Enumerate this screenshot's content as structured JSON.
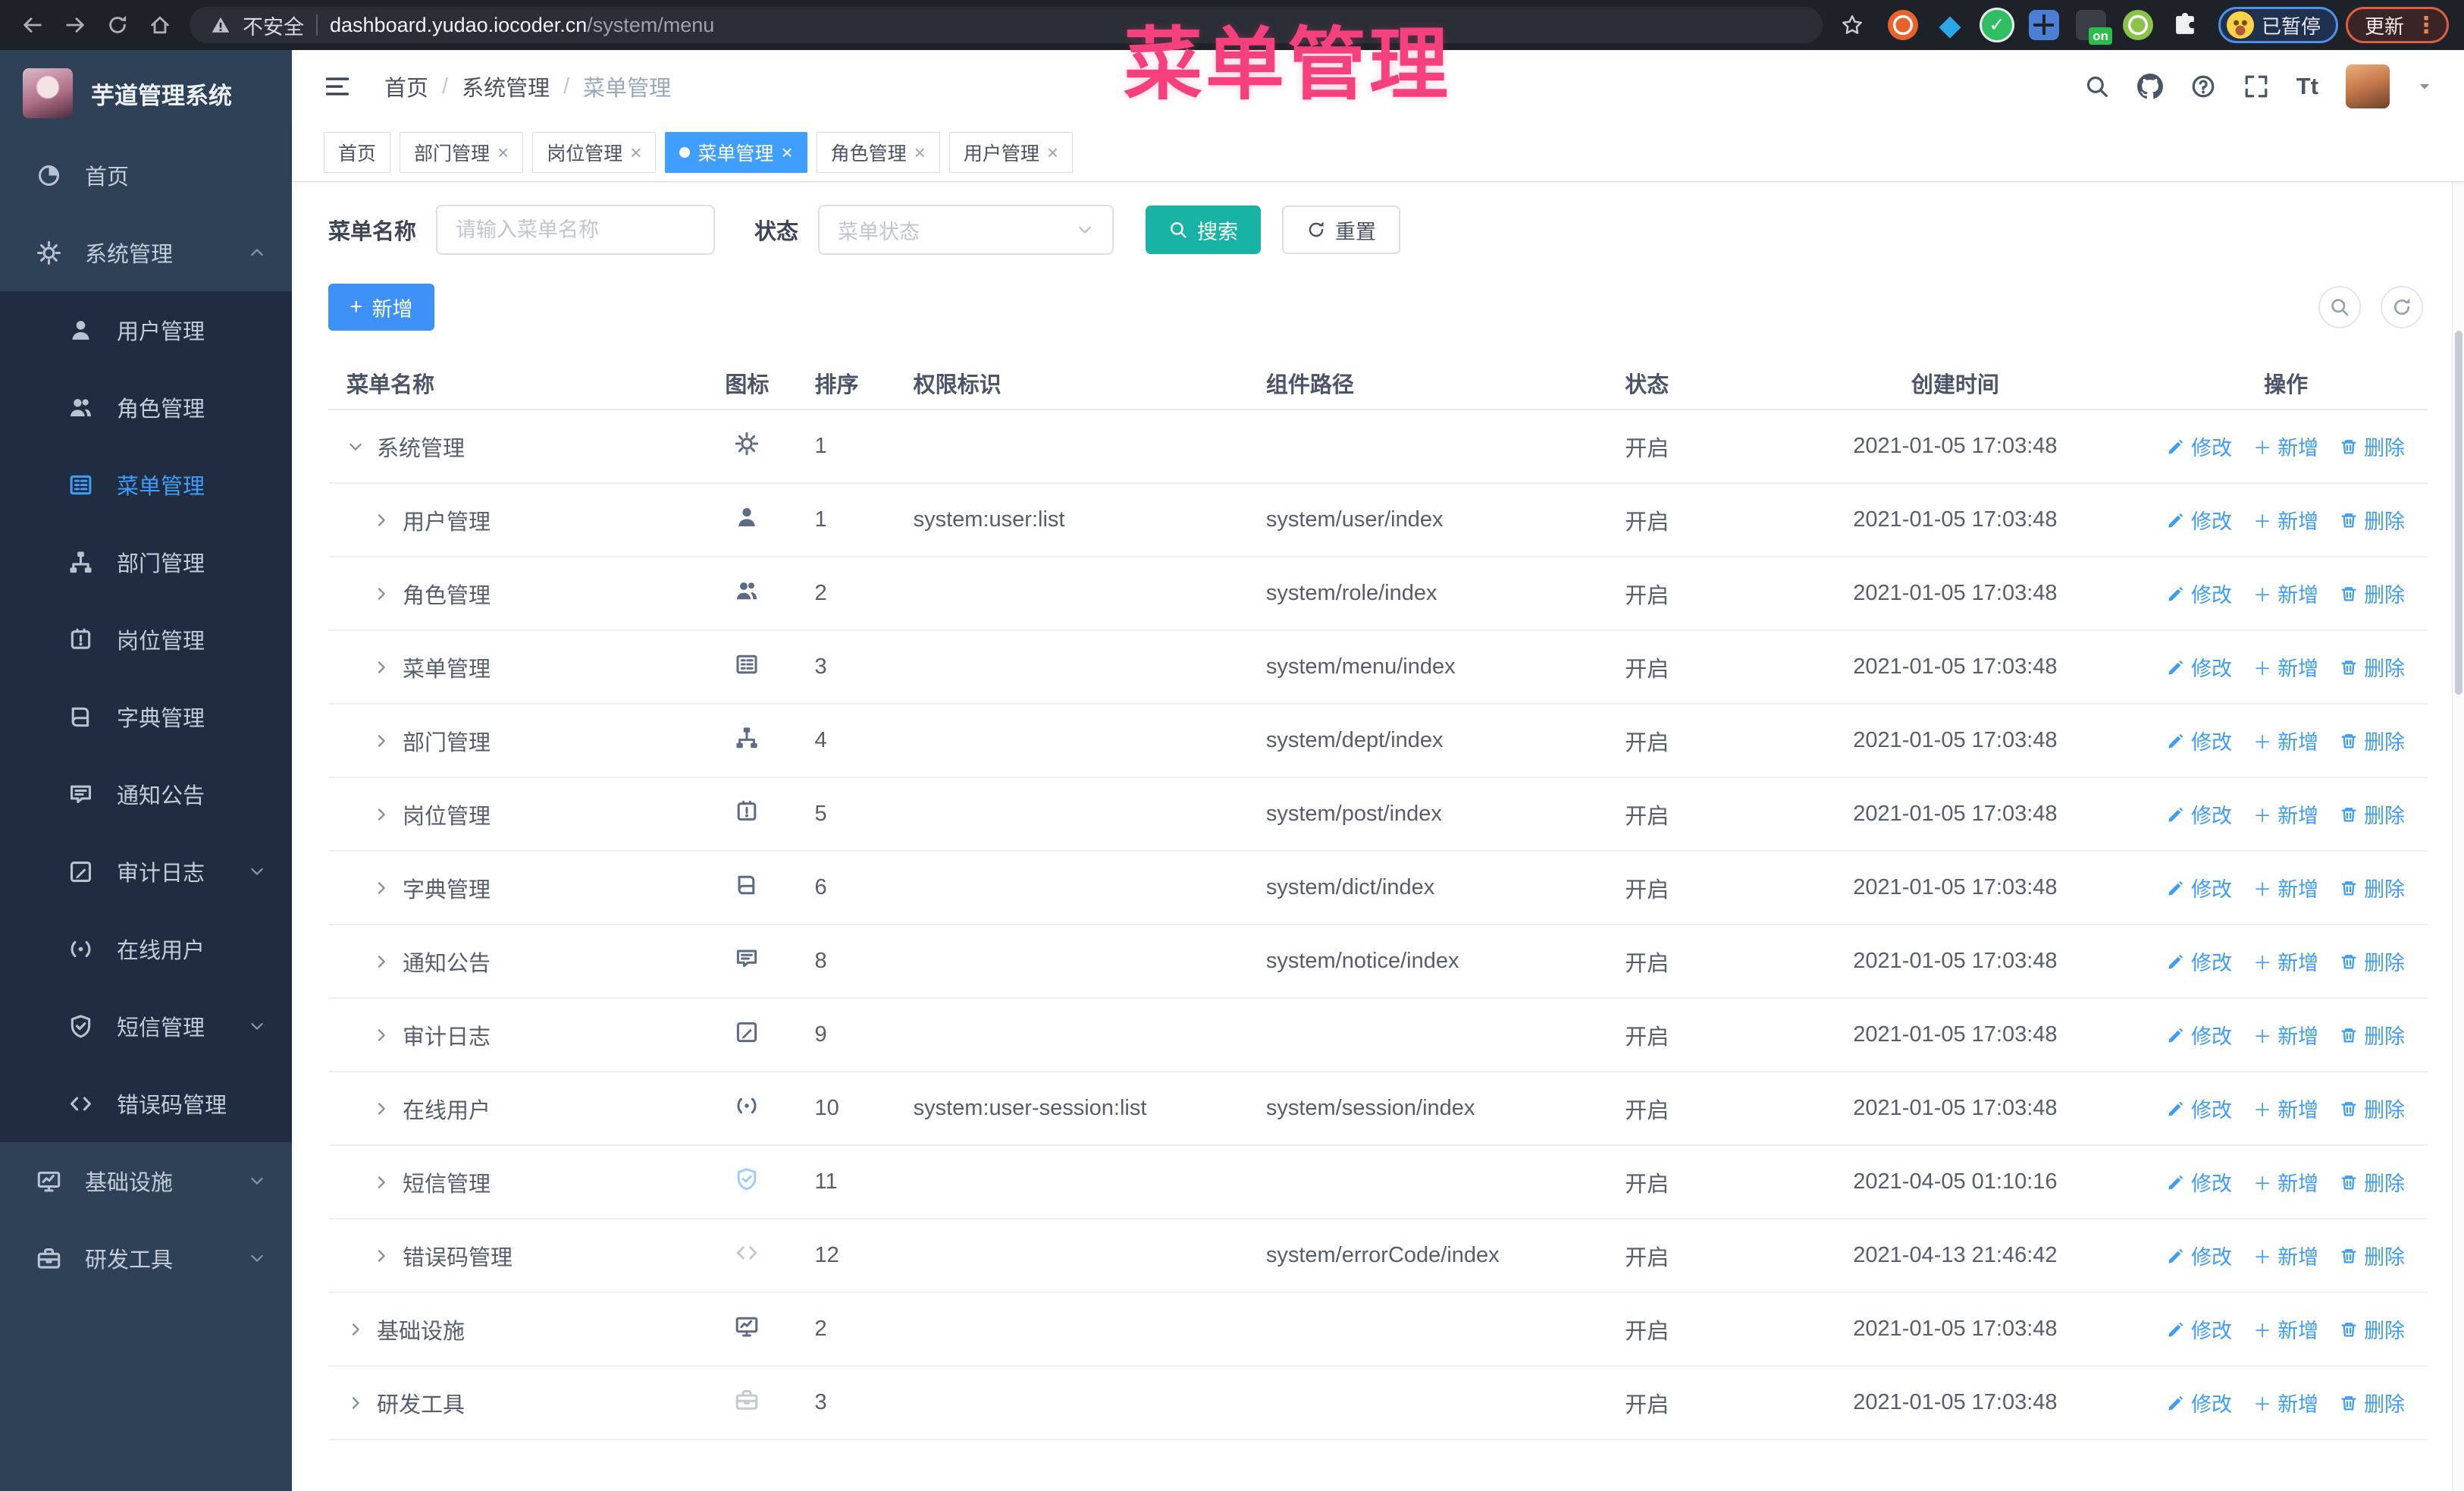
{
  "browser": {
    "security_label": "不安全",
    "url_host": "dashboard.yudao.iocoder.cn",
    "url_path": "/system/menu",
    "paused_badge": "已暂停",
    "update_label": "更新",
    "extensions": [
      {
        "key": "orange",
        "kind": "ring",
        "color": "#e8622c"
      },
      {
        "key": "blue-gem",
        "kind": "gem",
        "color": "#2aa7e6"
      },
      {
        "key": "green-check",
        "kind": "check",
        "color": "#2fbe62",
        "glyph": "✓"
      },
      {
        "key": "blue-grid",
        "kind": "grid",
        "color": "#4a7fd4"
      },
      {
        "key": "on-badge",
        "kind": "onbadge",
        "color": "#3a3f47",
        "badge": "on",
        "badge_color": "#2dbd4e"
      },
      {
        "key": "green-dot",
        "kind": "ring",
        "color": "#8bc34a"
      },
      {
        "key": "puzzle",
        "kind": "puzzle",
        "color": "#eef1f4"
      }
    ]
  },
  "overlay_title": "菜单管理",
  "sidebar": {
    "logo_title": "芋道管理系统",
    "items": [
      {
        "key": "home",
        "label": "首页",
        "icon": "dashboard-icon",
        "level": 0
      },
      {
        "key": "system",
        "label": "系统管理",
        "icon": "gear-icon",
        "level": 0,
        "caret": "up"
      },
      {
        "key": "user",
        "label": "用户管理",
        "icon": "user-icon",
        "level": 1
      },
      {
        "key": "role",
        "label": "角色管理",
        "icon": "users-icon",
        "level": 1
      },
      {
        "key": "menu",
        "label": "菜单管理",
        "icon": "menu-icon",
        "level": 1,
        "active": true
      },
      {
        "key": "dept",
        "label": "部门管理",
        "icon": "tree-icon",
        "level": 1
      },
      {
        "key": "post",
        "label": "岗位管理",
        "icon": "post-icon",
        "level": 1
      },
      {
        "key": "dict",
        "label": "字典管理",
        "icon": "dict-icon",
        "level": 1
      },
      {
        "key": "notice",
        "label": "通知公告",
        "icon": "notice-icon",
        "level": 1
      },
      {
        "key": "log",
        "label": "审计日志",
        "icon": "log-icon",
        "level": 1,
        "caret": "down"
      },
      {
        "key": "online",
        "label": "在线用户",
        "icon": "online-icon",
        "level": 1
      },
      {
        "key": "sms",
        "label": "短信管理",
        "icon": "shield-icon",
        "level": 1,
        "caret": "down"
      },
      {
        "key": "errcode",
        "label": "错误码管理",
        "icon": "code-icon",
        "level": 1
      },
      {
        "key": "infra",
        "label": "基础设施",
        "icon": "monitor-icon",
        "level": 0,
        "caret": "down"
      },
      {
        "key": "devtool",
        "label": "研发工具",
        "icon": "toolbox-icon",
        "level": 0,
        "caret": "down"
      }
    ]
  },
  "breadcrumb": {
    "items": [
      "首页",
      "系统管理",
      "菜单管理"
    ]
  },
  "tabs": [
    {
      "key": "home",
      "label": "首页",
      "closable": false,
      "active": false
    },
    {
      "key": "dept",
      "label": "部门管理",
      "closable": true,
      "active": false
    },
    {
      "key": "post",
      "label": "岗位管理",
      "closable": true,
      "active": false
    },
    {
      "key": "menu",
      "label": "菜单管理",
      "closable": true,
      "active": true
    },
    {
      "key": "role",
      "label": "角色管理",
      "closable": true,
      "active": false
    },
    {
      "key": "user",
      "label": "用户管理",
      "closable": true,
      "active": false
    }
  ],
  "filter": {
    "name_label": "菜单名称",
    "name_placeholder": "请输入菜单名称",
    "name_value": "",
    "status_label": "状态",
    "status_placeholder": "菜单状态",
    "search_label": "搜索",
    "reset_label": "重置"
  },
  "toolbar": {
    "add_label": "新增"
  },
  "table": {
    "columns": [
      "菜单名称",
      "图标",
      "排序",
      "权限标识",
      "组件路径",
      "状态",
      "创建时间",
      "操作"
    ],
    "action_labels": {
      "edit": "修改",
      "add": "新增",
      "remove": "删除"
    },
    "rows": [
      {
        "name": "系统管理",
        "level": 0,
        "arrow": "down",
        "icon": "gear-icon",
        "tone": "",
        "sort": "1",
        "perms": "",
        "path": "",
        "status": "开启",
        "time": "2021-01-05 17:03:48"
      },
      {
        "name": "用户管理",
        "level": 1,
        "arrow": "right",
        "icon": "user-icon",
        "tone": "",
        "sort": "1",
        "perms": "system:user:list",
        "path": "system/user/index",
        "status": "开启",
        "time": "2021-01-05 17:03:48"
      },
      {
        "name": "角色管理",
        "level": 1,
        "arrow": "right",
        "icon": "users-icon",
        "tone": "",
        "sort": "2",
        "perms": "",
        "path": "system/role/index",
        "status": "开启",
        "time": "2021-01-05 17:03:48"
      },
      {
        "name": "菜单管理",
        "level": 1,
        "arrow": "right",
        "icon": "menu-icon",
        "tone": "",
        "sort": "3",
        "perms": "",
        "path": "system/menu/index",
        "status": "开启",
        "time": "2021-01-05 17:03:48"
      },
      {
        "name": "部门管理",
        "level": 1,
        "arrow": "right",
        "icon": "tree-icon",
        "tone": "",
        "sort": "4",
        "perms": "",
        "path": "system/dept/index",
        "status": "开启",
        "time": "2021-01-05 17:03:48"
      },
      {
        "name": "岗位管理",
        "level": 1,
        "arrow": "right",
        "icon": "post-icon",
        "tone": "",
        "sort": "5",
        "perms": "",
        "path": "system/post/index",
        "status": "开启",
        "time": "2021-01-05 17:03:48"
      },
      {
        "name": "字典管理",
        "level": 1,
        "arrow": "right",
        "icon": "dict-icon",
        "tone": "",
        "sort": "6",
        "perms": "",
        "path": "system/dict/index",
        "status": "开启",
        "time": "2021-01-05 17:03:48"
      },
      {
        "name": "通知公告",
        "level": 1,
        "arrow": "right",
        "icon": "notice-icon",
        "tone": "",
        "sort": "8",
        "perms": "",
        "path": "system/notice/index",
        "status": "开启",
        "time": "2021-01-05 17:03:48"
      },
      {
        "name": "审计日志",
        "level": 1,
        "arrow": "right",
        "icon": "log-icon",
        "tone": "",
        "sort": "9",
        "perms": "",
        "path": "",
        "status": "开启",
        "time": "2021-01-05 17:03:48"
      },
      {
        "name": "在线用户",
        "level": 1,
        "arrow": "right",
        "icon": "online-icon",
        "tone": "",
        "sort": "10",
        "perms": "system:user-session:list",
        "path": "system/session/index",
        "status": "开启",
        "time": "2021-01-05 17:03:48"
      },
      {
        "name": "短信管理",
        "level": 1,
        "arrow": "right",
        "icon": "shield-icon",
        "tone": "blue",
        "sort": "11",
        "perms": "",
        "path": "",
        "status": "开启",
        "time": "2021-04-05 01:10:16"
      },
      {
        "name": "错误码管理",
        "level": 1,
        "arrow": "right",
        "icon": "code-icon",
        "tone": "muted",
        "sort": "12",
        "perms": "",
        "path": "system/errorCode/index",
        "status": "开启",
        "time": "2021-04-13 21:46:42"
      },
      {
        "name": "基础设施",
        "level": 0,
        "arrow": "right",
        "icon": "monitor-icon",
        "tone": "",
        "sort": "2",
        "perms": "",
        "path": "",
        "status": "开启",
        "time": "2021-01-05 17:03:48"
      },
      {
        "name": "研发工具",
        "level": 0,
        "arrow": "right",
        "icon": "toolbox-icon",
        "tone": "muted",
        "sort": "3",
        "perms": "",
        "path": "",
        "status": "开启",
        "time": "2021-01-05 17:03:48"
      }
    ]
  },
  "colors": {
    "accent": "#409eff",
    "search_button": "#18b3a4",
    "overlay_title": "#f4417d",
    "sidebar_bg": "#2e4156",
    "submenu_bg": "#202c40",
    "chrome_bg": "#1d2128"
  }
}
